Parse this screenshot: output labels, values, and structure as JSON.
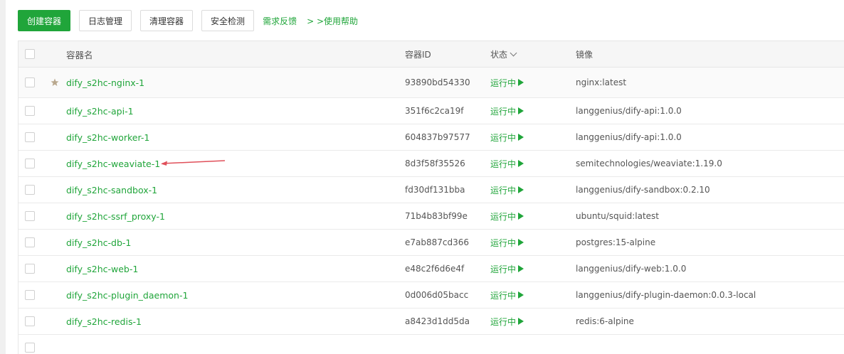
{
  "toolbar": {
    "create": "创建容器",
    "logs": "日志管理",
    "clean": "清理容器",
    "security": "安全检测",
    "feedback": "需求反馈",
    "help": "> >使用帮助"
  },
  "table": {
    "headers": {
      "name": "容器名",
      "id": "容器ID",
      "status": "状态",
      "image": "镜像"
    },
    "rows": [
      {
        "name": "dify_s2hc-nginx-1",
        "id": "93890bd54330",
        "status": "运行中",
        "image": "nginx:latest",
        "pinned": true
      },
      {
        "name": "dify_s2hc-api-1",
        "id": "351f6c2ca19f",
        "status": "运行中",
        "image": "langgenius/dify-api:1.0.0"
      },
      {
        "name": "dify_s2hc-worker-1",
        "id": "604837b97577",
        "status": "运行中",
        "image": "langgenius/dify-api:1.0.0"
      },
      {
        "name": "dify_s2hc-weaviate-1",
        "id": "8d3f58f35526",
        "status": "运行中",
        "image": "semitechnologies/weaviate:1.19.0",
        "annotated": true
      },
      {
        "name": "dify_s2hc-sandbox-1",
        "id": "fd30df131bba",
        "status": "运行中",
        "image": "langgenius/dify-sandbox:0.2.10"
      },
      {
        "name": "dify_s2hc-ssrf_proxy-1",
        "id": "71b4b83bf99e",
        "status": "运行中",
        "image": "ubuntu/squid:latest"
      },
      {
        "name": "dify_s2hc-db-1",
        "id": "e7ab887cd366",
        "status": "运行中",
        "image": "postgres:15-alpine"
      },
      {
        "name": "dify_s2hc-web-1",
        "id": "e48c2f6d6e4f",
        "status": "运行中",
        "image": "langgenius/dify-web:1.0.0"
      },
      {
        "name": "dify_s2hc-plugin_daemon-1",
        "id": "0d006d05bacc",
        "status": "运行中",
        "image": "langgenius/dify-plugin-daemon:0.0.3-local"
      },
      {
        "name": "dify_s2hc-redis-1",
        "id": "a8423d1dd5da",
        "status": "运行中",
        "image": "redis:6-alpine"
      },
      {
        "name": "",
        "id": "",
        "status": "",
        "image": ""
      }
    ]
  },
  "colors": {
    "accent": "#20a53a",
    "annotation": "#e0505a"
  }
}
